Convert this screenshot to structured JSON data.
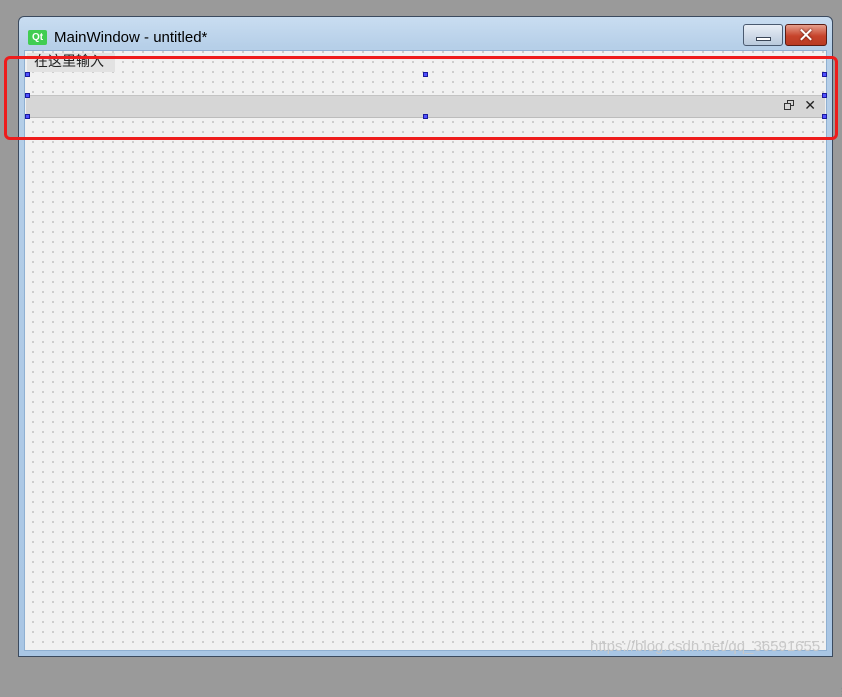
{
  "window": {
    "app_logo_text": "Qt",
    "title": "MainWindow - untitled*",
    "minimize_symbol": "",
    "close_symbol": "✕"
  },
  "menubar": {
    "item_label": "在这里输入"
  },
  "dock": {
    "float_icon": "float-icon",
    "close_symbol": "✕"
  },
  "colors": {
    "highlight": "#ee1c1c",
    "selection_handle": "#5050ff",
    "qt_green": "#41cd52"
  },
  "watermark": "https://blog.csdn.net/qq_36591655"
}
